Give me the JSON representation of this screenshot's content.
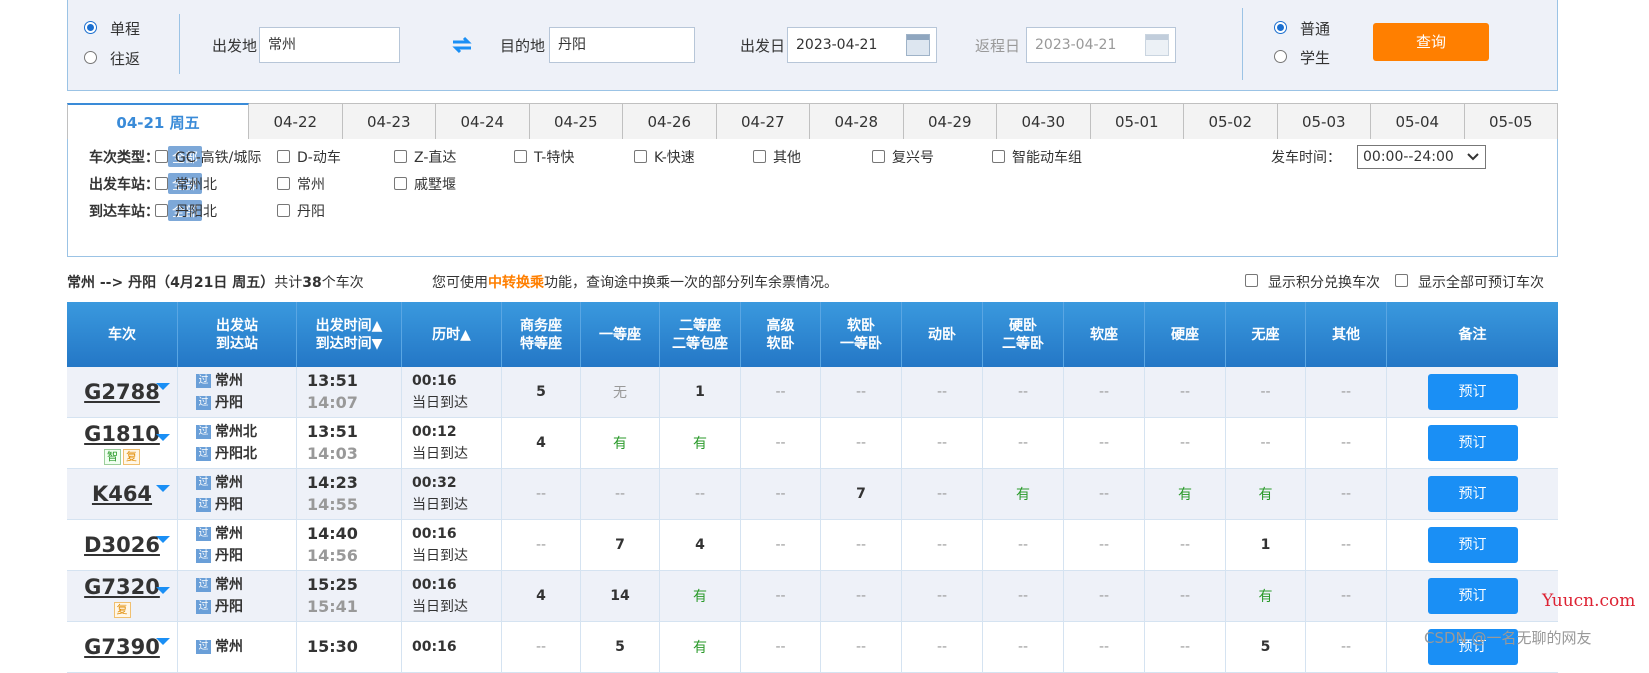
{
  "search": {
    "trip_options": [
      {
        "label": "单程",
        "selected": true
      },
      {
        "label": "往返",
        "selected": false
      }
    ],
    "from_label": "出发地",
    "from_value": "常州",
    "to_label": "目的地",
    "to_value": "丹阳",
    "depart_label": "出发日",
    "depart_value": "2023-04-21",
    "return_label": "返程日",
    "return_value": "2023-04-21",
    "ticket_options": [
      {
        "label": "普通",
        "selected": true
      },
      {
        "label": "学生",
        "selected": false
      }
    ],
    "query_label": "查询",
    "swap_icon": "swap-arrows-icon",
    "calendar_icon": "calendar-icon"
  },
  "date_tabs": [
    "04-21 周五",
    "04-22",
    "04-23",
    "04-24",
    "04-25",
    "04-26",
    "04-27",
    "04-28",
    "04-29",
    "04-30",
    "05-01",
    "05-02",
    "05-03",
    "05-04",
    "05-05"
  ],
  "filters": {
    "train_type_label": "车次类型：",
    "all_label": "全部",
    "train_types": [
      "GC-高铁/城际",
      "D-动车",
      "Z-直达",
      "T-特快",
      "K-快速",
      "其他",
      "复兴号",
      "智能动车组"
    ],
    "depart_station_label": "出发车站：",
    "depart_stations": [
      "常州北",
      "常州",
      "戚墅堰"
    ],
    "arrive_station_label": "到达车站：",
    "arrive_stations": [
      "丹阳北",
      "丹阳"
    ],
    "depart_time_label": "发车时间：",
    "depart_time_value": "00:00--24:00"
  },
  "summary": {
    "route": "常州 --> 丹阳（4月21日  周五）",
    "count_prefix": "共计",
    "count": "38",
    "count_suffix": "个车次",
    "hint_prefix": "您可使用",
    "hint_link": "中转换乘",
    "hint_suffix": "功能，查询途中换乘一次的部分列车余票情况。",
    "opt_points": "显示积分兑换车次",
    "opt_all": "显示全部可预订车次"
  },
  "table": {
    "headers": [
      {
        "l1": "车次",
        "l2": ""
      },
      {
        "l1": "出发站",
        "l2": "到达站"
      },
      {
        "l1": "出发时间▲",
        "l2": "到达时间▼"
      },
      {
        "l1": "历时▲",
        "l2": ""
      },
      {
        "l1": "商务座",
        "l2": "特等座"
      },
      {
        "l1": "一等座",
        "l2": ""
      },
      {
        "l1": "二等座",
        "l2": "二等包座"
      },
      {
        "l1": "高级",
        "l2": "软卧"
      },
      {
        "l1": "软卧",
        "l2": "一等卧"
      },
      {
        "l1": "动卧",
        "l2": ""
      },
      {
        "l1": "硬卧",
        "l2": "二等卧"
      },
      {
        "l1": "软座",
        "l2": ""
      },
      {
        "l1": "硬座",
        "l2": ""
      },
      {
        "l1": "无座",
        "l2": ""
      },
      {
        "l1": "其他",
        "l2": ""
      },
      {
        "l1": "备注",
        "l2": ""
      }
    ],
    "pass_badge": "过",
    "book_label": "预订",
    "rows": [
      {
        "train": "G2788",
        "tags": [],
        "from": "常州",
        "to": "丹阳",
        "dep": "13:51",
        "arr": "14:07",
        "dur": "00:16",
        "arr_day": "当日到达",
        "seats": [
          "5",
          "无",
          "1",
          "--",
          "--",
          "--",
          "--",
          "--",
          "--",
          "--",
          "--"
        ]
      },
      {
        "train": "G1810",
        "tags": [
          "智",
          "复"
        ],
        "from": "常州北",
        "to": "丹阳北",
        "dep": "13:51",
        "arr": "14:03",
        "dur": "00:12",
        "arr_day": "当日到达",
        "seats": [
          "4",
          "有",
          "有",
          "--",
          "--",
          "--",
          "--",
          "--",
          "--",
          "--",
          "--"
        ]
      },
      {
        "train": "K464",
        "tags": [],
        "from": "常州",
        "to": "丹阳",
        "dep": "14:23",
        "arr": "14:55",
        "dur": "00:32",
        "arr_day": "当日到达",
        "seats": [
          "--",
          "--",
          "--",
          "--",
          "7",
          "--",
          "有",
          "--",
          "有",
          "有",
          "--"
        ]
      },
      {
        "train": "D3026",
        "tags": [],
        "from": "常州",
        "to": "丹阳",
        "dep": "14:40",
        "arr": "14:56",
        "dur": "00:16",
        "arr_day": "当日到达",
        "seats": [
          "--",
          "7",
          "4",
          "--",
          "--",
          "--",
          "--",
          "--",
          "--",
          "1",
          "--"
        ]
      },
      {
        "train": "G7320",
        "tags": [
          "复"
        ],
        "from": "常州",
        "to": "丹阳",
        "dep": "15:25",
        "arr": "15:41",
        "dur": "00:16",
        "arr_day": "当日到达",
        "seats": [
          "4",
          "14",
          "有",
          "--",
          "--",
          "--",
          "--",
          "--",
          "--",
          "有",
          "--"
        ]
      },
      {
        "train": "G7390",
        "tags": [],
        "from": "常州",
        "to": "",
        "dep": "15:30",
        "arr": "",
        "dur": "00:16",
        "arr_day": "",
        "seats": [
          "--",
          "5",
          "有",
          "--",
          "--",
          "--",
          "--",
          "--",
          "--",
          "5",
          "--"
        ]
      }
    ]
  },
  "watermarks": {
    "yuucn": "Yuucn.com",
    "csdn": "CSDN @一名无聊的网友"
  }
}
